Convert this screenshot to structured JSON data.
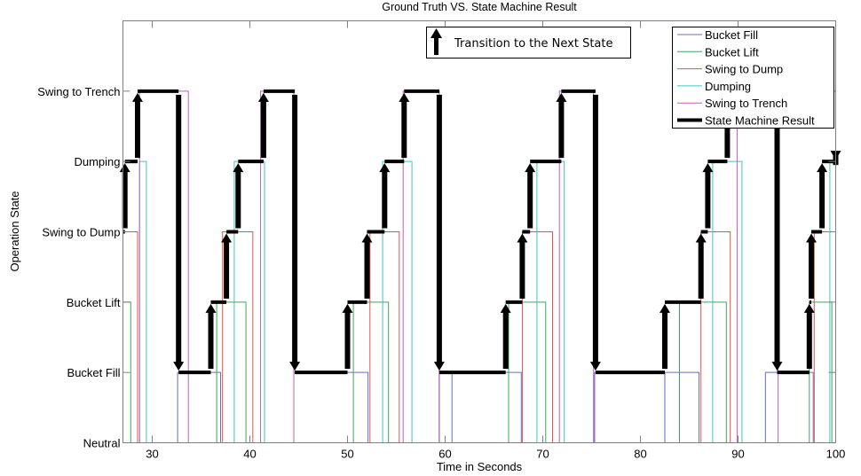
{
  "chart_data": {
    "type": "line",
    "title": "Ground Truth VS. State Machine Result",
    "xlabel": "Time in Seconds",
    "ylabel": "Operation State",
    "xlim": [
      27,
      100
    ],
    "ylim": [
      0,
      6
    ],
    "xticks": [
      30,
      40,
      50,
      60,
      70,
      80,
      90,
      100
    ],
    "xtick_labels": [
      "30",
      "40",
      "50",
      "60",
      "70",
      "80",
      "90",
      "100"
    ],
    "yticks": [
      0,
      1,
      2,
      3,
      4,
      5
    ],
    "ytick_labels": [
      "Neutral",
      "Bucket Fill",
      "Bucket Lift",
      "Swing to Dump",
      "Dumping",
      "Swing to Trench"
    ],
    "grid": false,
    "legend_position": "top-right",
    "annotation": {
      "text": "Transition to the Next State",
      "icon": "up-arrow-icon"
    },
    "series": [
      {
        "name": "Bucket Fill",
        "color": "#6b6bc8",
        "level": 1,
        "intervals": [
          [
            32.6,
            37.0
          ],
          [
            44.5,
            52.1
          ],
          [
            59.4,
            60.7
          ],
          [
            59.4,
            67.8
          ],
          [
            75.3,
            82.5
          ],
          [
            75.3,
            86.0
          ],
          [
            92.8,
            97.7
          ]
        ]
      },
      {
        "name": "Bucket Lift",
        "color": "#3aa85a",
        "level": 2,
        "intervals": [
          [
            27.0,
            27.8
          ],
          [
            36.6,
            39.6
          ],
          [
            50.6,
            54.2
          ],
          [
            66.5,
            70.3
          ],
          [
            84.0,
            88.8
          ],
          [
            97.3,
            99.6
          ]
        ]
      },
      {
        "name": "Swing to Dump",
        "color": "#e8504a",
        "level": 3,
        "intervals": [
          [
            27.0,
            28.5
          ],
          [
            37.2,
            40.3
          ],
          [
            52.3,
            55.3
          ],
          [
            67.9,
            71.0
          ],
          [
            86.2,
            89.2
          ],
          [
            97.8,
            100.0
          ]
        ]
      },
      {
        "name": "Dumping",
        "color": "#40c4c0",
        "level": 4,
        "intervals": [
          [
            28.7,
            29.4
          ],
          [
            38.4,
            41.5
          ],
          [
            53.6,
            56.6
          ],
          [
            69.4,
            72.2
          ],
          [
            87.4,
            90.4
          ],
          [
            99.4,
            100.0
          ]
        ]
      },
      {
        "name": "Swing to Trench",
        "color": "#b860b8",
        "level": 5,
        "intervals": [
          [
            28.7,
            33.7
          ],
          [
            41.1,
            44.5
          ],
          [
            55.7,
            59.4
          ],
          [
            71.7,
            75.2
          ],
          [
            89.9,
            94.1
          ]
        ]
      },
      {
        "name": "State Machine Result",
        "color": "#000000",
        "level": null,
        "steps": [
          [
            27.0,
            3
          ],
          [
            27.2,
            4
          ],
          [
            28.5,
            5
          ],
          [
            32.7,
            1
          ],
          [
            36.0,
            2
          ],
          [
            37.6,
            3
          ],
          [
            38.8,
            4
          ],
          [
            41.4,
            5
          ],
          [
            44.6,
            1
          ],
          [
            50.0,
            2
          ],
          [
            52.0,
            3
          ],
          [
            53.8,
            4
          ],
          [
            55.8,
            5
          ],
          [
            59.4,
            1
          ],
          [
            66.2,
            2
          ],
          [
            67.9,
            3
          ],
          [
            68.7,
            4
          ],
          [
            71.9,
            5
          ],
          [
            75.4,
            1
          ],
          [
            82.5,
            2
          ],
          [
            86.2,
            3
          ],
          [
            86.9,
            4
          ],
          [
            88.9,
            5
          ],
          [
            94.0,
            1
          ],
          [
            97.3,
            2
          ],
          [
            97.5,
            3
          ],
          [
            98.6,
            4
          ],
          [
            100.0,
            4
          ]
        ]
      }
    ]
  }
}
